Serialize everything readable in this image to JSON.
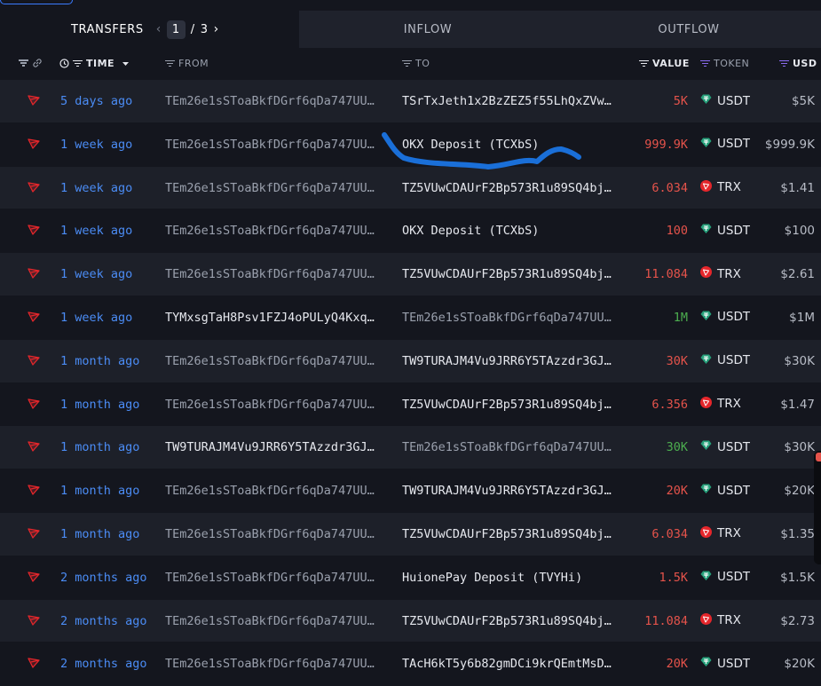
{
  "tabs": {
    "transfers": "TRANSFERS",
    "page_current": "1",
    "page_separator": "/",
    "page_total": "3",
    "inflow": "INFLOW",
    "outflow": "OUTFLOW"
  },
  "columns": {
    "time": "TIME",
    "from": "FROM",
    "to": "TO",
    "value": "VALUE",
    "token": "TOKEN",
    "usd": "USD"
  },
  "colors": {
    "accent": "#4b8cf5",
    "outflow_value": "#e5534b",
    "inflow_value": "#4cae4f",
    "tron_red": "#e5262b",
    "usdt_teal": "#26a17b",
    "filter_purple": "#8b6cf0",
    "scribble": "#1a6fd8"
  },
  "rows": [
    {
      "time": "5 days ago",
      "from": "TEm26e1sSToaBkfDGrf6qDa747UU…",
      "to": "TSrTxJeth1x2BzZEZ5f55LhQxZVw…",
      "value": "5K",
      "direction": "out",
      "token": "USDT",
      "usd": "$5K"
    },
    {
      "time": "1 week ago",
      "from": "TEm26e1sSToaBkfDGrf6qDa747UU…",
      "to": "OKX Deposit (TCXbS)",
      "value": "999.9K",
      "direction": "out",
      "token": "USDT",
      "usd": "$999.9K"
    },
    {
      "time": "1 week ago",
      "from": "TEm26e1sSToaBkfDGrf6qDa747UU…",
      "to": "TZ5VUwCDAUrF2Bp573R1u89SQ4bj…",
      "value": "6.034",
      "direction": "out",
      "token": "TRX",
      "usd": "$1.41"
    },
    {
      "time": "1 week ago",
      "from": "TEm26e1sSToaBkfDGrf6qDa747UU…",
      "to": "OKX Deposit (TCXbS)",
      "value": "100",
      "direction": "out",
      "token": "USDT",
      "usd": "$100"
    },
    {
      "time": "1 week ago",
      "from": "TEm26e1sSToaBkfDGrf6qDa747UU…",
      "to": "TZ5VUwCDAUrF2Bp573R1u89SQ4bj…",
      "value": "11.084",
      "direction": "out",
      "token": "TRX",
      "usd": "$2.61"
    },
    {
      "time": "1 week ago",
      "from": "TYMxsgTaH8Psv1FZJ4oPULyQ4Kxq…",
      "to": "TEm26e1sSToaBkfDGrf6qDa747UU…",
      "value": "1M",
      "direction": "in",
      "token": "USDT",
      "usd": "$1M"
    },
    {
      "time": "1 month ago",
      "from": "TEm26e1sSToaBkfDGrf6qDa747UU…",
      "to": "TW9TURAJM4Vu9JRR6Y5TAzzdr3GJ…",
      "value": "30K",
      "direction": "out",
      "token": "USDT",
      "usd": "$30K"
    },
    {
      "time": "1 month ago",
      "from": "TEm26e1sSToaBkfDGrf6qDa747UU…",
      "to": "TZ5VUwCDAUrF2Bp573R1u89SQ4bj…",
      "value": "6.356",
      "direction": "out",
      "token": "TRX",
      "usd": "$1.47"
    },
    {
      "time": "1 month ago",
      "from": "TW9TURAJM4Vu9JRR6Y5TAzzdr3GJ…",
      "to": "TEm26e1sSToaBkfDGrf6qDa747UU…",
      "value": "30K",
      "direction": "in",
      "token": "USDT",
      "usd": "$30K"
    },
    {
      "time": "1 month ago",
      "from": "TEm26e1sSToaBkfDGrf6qDa747UU…",
      "to": "TW9TURAJM4Vu9JRR6Y5TAzzdr3GJ…",
      "value": "20K",
      "direction": "out",
      "token": "USDT",
      "usd": "$20K"
    },
    {
      "time": "1 month ago",
      "from": "TEm26e1sSToaBkfDGrf6qDa747UU…",
      "to": "TZ5VUwCDAUrF2Bp573R1u89SQ4bj…",
      "value": "6.034",
      "direction": "out",
      "token": "TRX",
      "usd": "$1.35"
    },
    {
      "time": "2 months ago",
      "from": "TEm26e1sSToaBkfDGrf6qDa747UU…",
      "to": "HuionePay Deposit (TVYHi)",
      "value": "1.5K",
      "direction": "out",
      "token": "USDT",
      "usd": "$1.5K"
    },
    {
      "time": "2 months ago",
      "from": "TEm26e1sSToaBkfDGrf6qDa747UU…",
      "to": "TZ5VUwCDAUrF2Bp573R1u89SQ4bj…",
      "value": "11.084",
      "direction": "out",
      "token": "TRX",
      "usd": "$2.73"
    },
    {
      "time": "2 months ago",
      "from": "TEm26e1sSToaBkfDGrf6qDa747UU…",
      "to": "TAcH6kT5y6b82gmDCi9krQEmtMsD…",
      "value": "20K",
      "direction": "out",
      "token": "USDT",
      "usd": "$20K"
    }
  ]
}
